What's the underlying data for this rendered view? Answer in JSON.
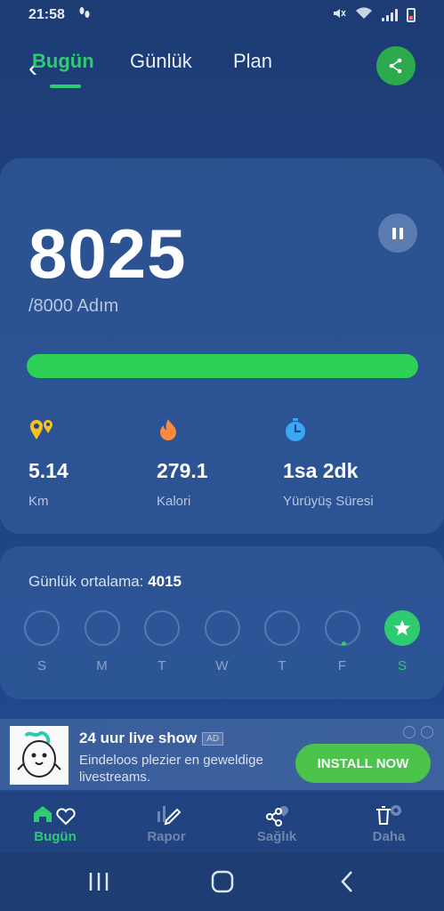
{
  "status_bar": {
    "time": "21:58",
    "activity_icon": "footsteps-icon",
    "icons": [
      "mute-icon",
      "wifi-icon",
      "signal-icon",
      "battery-icon"
    ]
  },
  "tabs": {
    "items": [
      {
        "label": "Bugün",
        "active": true
      },
      {
        "label": "Günlük",
        "active": false
      },
      {
        "label": "Plan",
        "active": false
      }
    ]
  },
  "summary": {
    "steps": "8025",
    "goal_text": "/8000 Adım",
    "progress_percent": 100,
    "stats": [
      {
        "icon": "distance-icon",
        "value": "5.14",
        "label": "Km",
        "color": "#f7c21f"
      },
      {
        "icon": "flame-icon",
        "value": "279.1",
        "label": "Kalori",
        "color": "#ff8a3d"
      },
      {
        "icon": "stopwatch-icon",
        "value": "1sa 2dk",
        "label": "Yürüyüş Süresi",
        "color": "#3aa8f3"
      }
    ]
  },
  "week": {
    "avg_label": "Günlük ortalama:",
    "avg_value": "4015",
    "days": [
      {
        "label": "S",
        "done": false,
        "partial": false
      },
      {
        "label": "M",
        "done": false,
        "partial": false
      },
      {
        "label": "T",
        "done": false,
        "partial": false
      },
      {
        "label": "W",
        "done": false,
        "partial": false
      },
      {
        "label": "T",
        "done": false,
        "partial": false
      },
      {
        "label": "F",
        "done": false,
        "partial": true
      },
      {
        "label": "S",
        "done": true,
        "partial": false
      }
    ]
  },
  "ad": {
    "title": "24 uur live show",
    "badge": "AD",
    "description": "Eindeloos plezier en geweldige livestreams.",
    "button": "INSTALL NOW"
  },
  "bottom_nav": {
    "items": [
      {
        "label": "Bugün",
        "icon": "home-icon",
        "active": true
      },
      {
        "label": "Rapor",
        "icon": "report-icon",
        "active": false
      },
      {
        "label": "Sağlık",
        "icon": "health-icon",
        "active": false
      },
      {
        "label": "Daha",
        "icon": "more-icon",
        "active": false
      }
    ]
  },
  "colors": {
    "accent": "#2ecc71",
    "background": "#1f4384"
  }
}
